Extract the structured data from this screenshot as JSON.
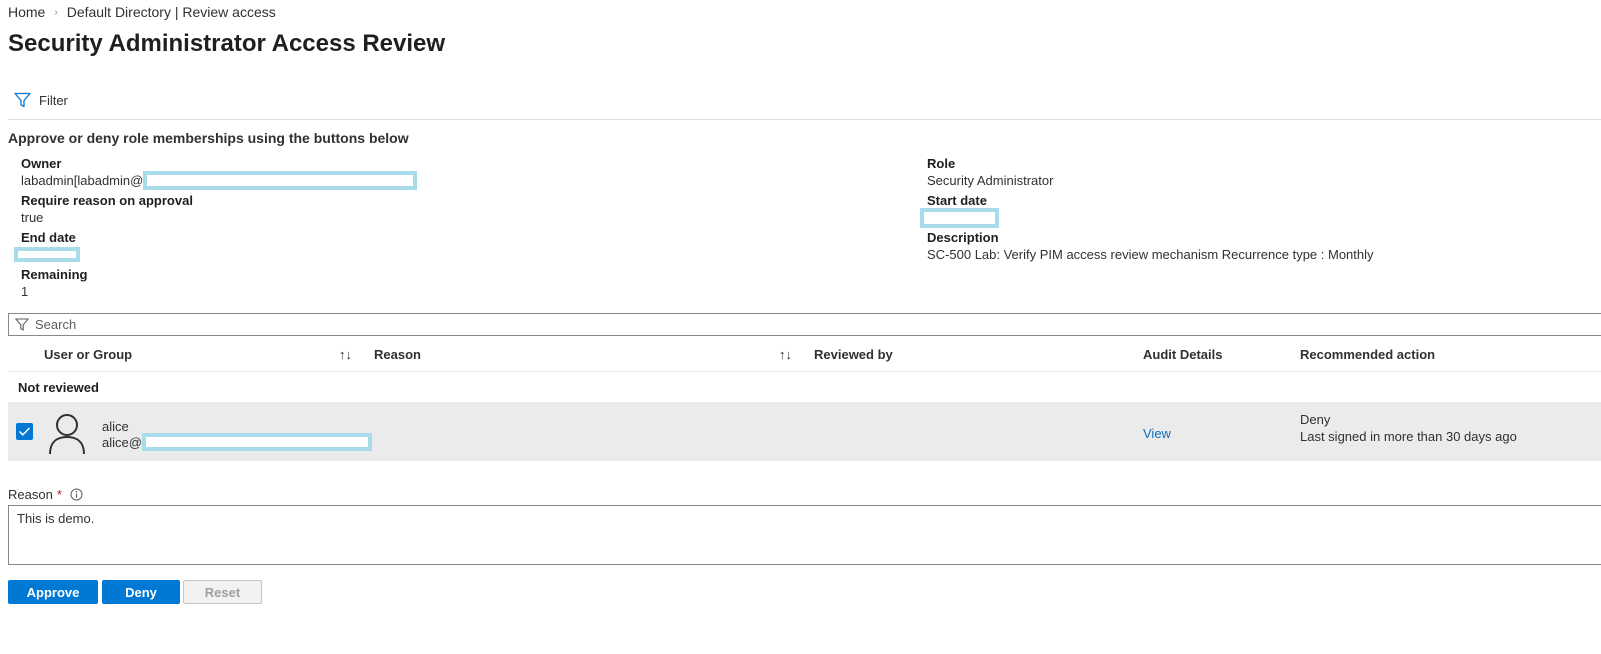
{
  "breadcrumb": {
    "items": [
      "Home",
      "Default Directory | Review access"
    ],
    "separator": "›"
  },
  "page": {
    "title": "Security Administrator Access Review",
    "more_glyph": "···"
  },
  "toolbar": {
    "filter_label": "Filter"
  },
  "section_heading": "Approve or deny role memberships using the buttons below",
  "properties": {
    "owner_label": "Owner",
    "owner_value": "labadmin[labadmin@",
    "require_reason_label": "Require reason on approval",
    "require_reason_value": "true",
    "end_date_label": "End date",
    "remaining_label": "Remaining",
    "remaining_value": "1",
    "role_label": "Role",
    "role_value": "Security Administrator",
    "start_date_label": "Start date",
    "description_label": "Description",
    "description_value": "SC-500 Lab: Verify PIM access review mechanism Recurrence type : Monthly"
  },
  "search": {
    "placeholder": "Search"
  },
  "table": {
    "columns": [
      "User or Group",
      "Reason",
      "Reviewed by",
      "Audit Details",
      "Recommended action"
    ],
    "sort_glyph": "↑↓",
    "group_label": "Not reviewed",
    "rows": [
      {
        "name": "alice",
        "email": "alice@",
        "audit_link": "View",
        "recommended_action": "Deny",
        "recommendation_reason": "Last signed in more than 30 days ago",
        "selected": true
      }
    ]
  },
  "reason_field": {
    "label": "Reason",
    "required_marker": "*",
    "value": "This is demo."
  },
  "actions": {
    "approve": "Approve",
    "deny": "Deny",
    "reset": "Reset"
  },
  "colors": {
    "primary": "#0078d4",
    "link": "#0f6cbd",
    "redaction": "#a8dcea",
    "selected_row": "#ebebeb",
    "required": "#a4262c"
  },
  "icons": [
    "filter-icon",
    "sort-icon",
    "checkmark-icon",
    "person-icon",
    "info-icon"
  ]
}
